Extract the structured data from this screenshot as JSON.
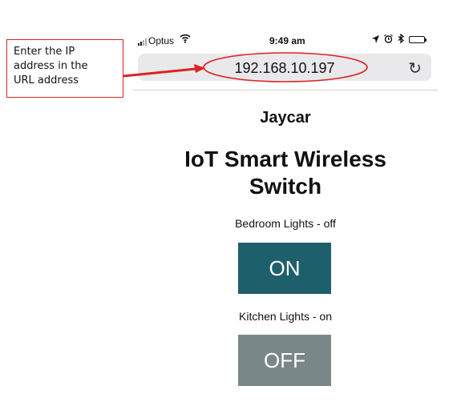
{
  "callout": {
    "lines": [
      "Enter the IP",
      "address in the",
      "URL address"
    ],
    "color": "#dd2222"
  },
  "status_bar": {
    "carrier": "Optus",
    "time": "9:49 am",
    "icons": [
      "signal-icon",
      "wifi-icon",
      "location-icon",
      "alarm-icon",
      "bluetooth-icon",
      "battery-icon"
    ]
  },
  "browser": {
    "url": "192.168.10.197",
    "reload_icon": "reload-icon"
  },
  "page": {
    "brand": "Jaycar",
    "title": "IoT Smart Wireless Switch",
    "switches": [
      {
        "label": "Bedroom Lights - off",
        "button": "ON",
        "color": "#1e5f6c"
      },
      {
        "label": "Kitchen Lights - on",
        "button": "OFF",
        "color": "#798788"
      }
    ]
  }
}
